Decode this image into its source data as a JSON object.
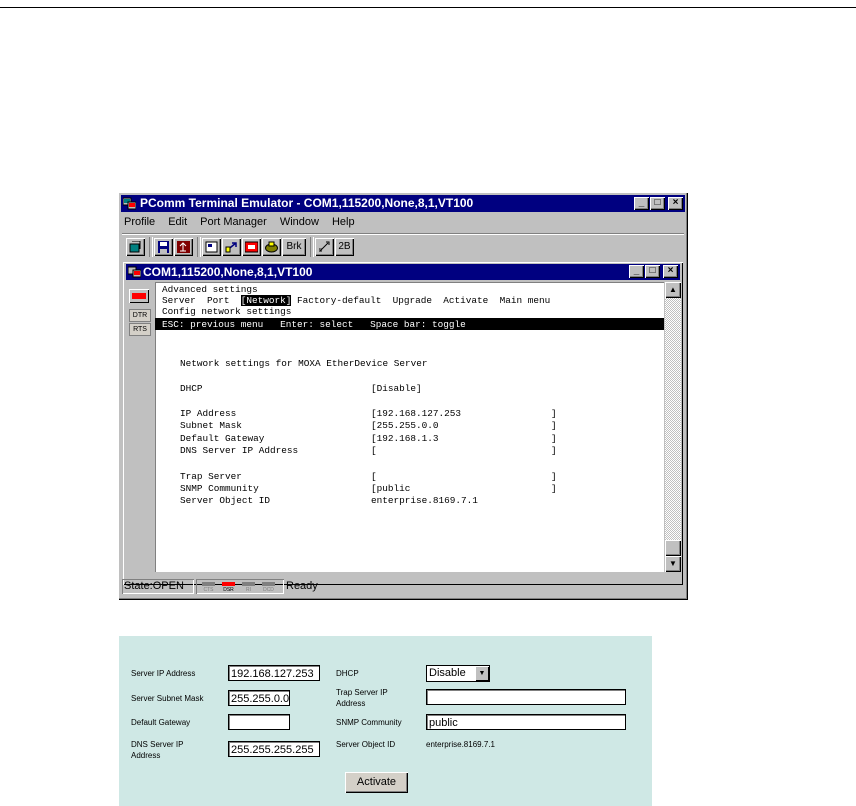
{
  "window": {
    "title": "PComm Terminal Emulator - COM1,115200,None,8,1,VT100",
    "menu": [
      "Profile",
      "Edit",
      "Port Manager",
      "Window",
      "Help"
    ],
    "toolbar_brk": "Brk",
    "toolbar_2b": "2B",
    "min": "_",
    "max": "□",
    "close": "×"
  },
  "child_window": {
    "title": "COM1,115200,None,8,1,VT100"
  },
  "signals": {
    "dtr": "DTR",
    "rts": "RTS"
  },
  "terminal": {
    "line1": "Advanced settings",
    "menu_pre": "Server  Port  ",
    "menu_selected": "[Network]",
    "menu_post": " Factory-default  Upgrade  Activate  Main menu",
    "line3": "Config network settings",
    "help_line": "ESC: previous menu   Enter: select   Space bar: toggle",
    "header": "Network settings for MOXA EtherDevice Server",
    "rows": [
      {
        "label": "DHCP",
        "value": "[Disable]"
      },
      {
        "label": "IP Address",
        "value": "[192.168.127.253                ]"
      },
      {
        "label": "Subnet Mask",
        "value": "[255.255.0.0                    ]"
      },
      {
        "label": "Default Gateway",
        "value": "[192.168.1.3                    ]"
      },
      {
        "label": "DNS Server IP Address",
        "value": "[                               ]"
      },
      {
        "label": "Trap Server",
        "value": "[                               ]"
      },
      {
        "label": "SNMP Community",
        "value": "[public                         ]"
      },
      {
        "label": "Server Object ID",
        "value": "enterprise.8169.7.1"
      }
    ]
  },
  "status_bar": {
    "state": "State:OPEN",
    "indicators": [
      "CTS",
      "DSR",
      "RI",
      "DCD"
    ],
    "message": "Ready"
  },
  "web_form": {
    "server_ip_label": "Server IP Address",
    "server_ip_value": "192.168.127.253",
    "subnet_label": "Server Subnet Mask",
    "subnet_value": "255.255.0.0",
    "gateway_label": "Default Gateway",
    "gateway_value": "",
    "dns_label_1": "DNS Server IP",
    "dns_label_2": "Address",
    "dns_value": "255.255.255.255",
    "dhcp_label": "DHCP",
    "dhcp_value": "Disable",
    "trap_label_1": "Trap Server IP",
    "trap_label_2": "Address",
    "trap_value": "",
    "snmp_label": "SNMP Community",
    "snmp_value": "public",
    "oid_label": "Server Object ID",
    "oid_value": "enterprise.8169.7.1",
    "activate": "Activate"
  }
}
